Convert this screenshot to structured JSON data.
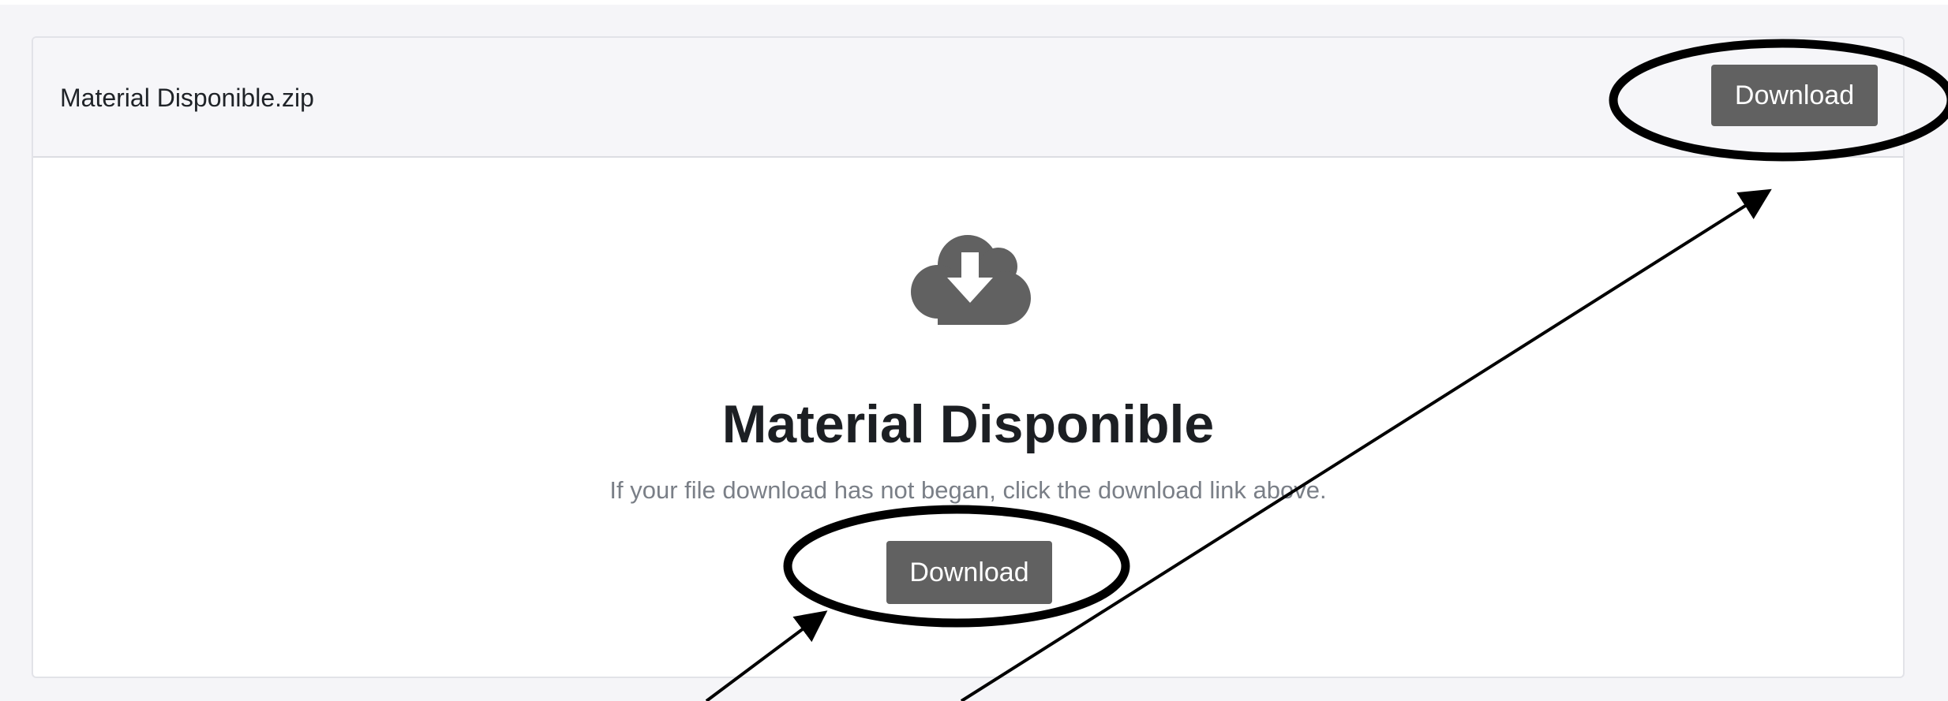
{
  "header": {
    "file_name": "Material Disponible.zip",
    "download_label": "Download"
  },
  "main": {
    "icon": "cloud-download-icon",
    "title": "Material Disponible",
    "message": "If your file download has not began, click the download link above.",
    "download_label": "Download"
  },
  "colors": {
    "button_bg": "#616161",
    "button_text": "#ffffff",
    "header_bg": "#f6f6f9",
    "page_bg": "#f5f5f8",
    "title_text": "#1c1f23",
    "message_text": "#7a7f87",
    "annotation": "#000000"
  }
}
